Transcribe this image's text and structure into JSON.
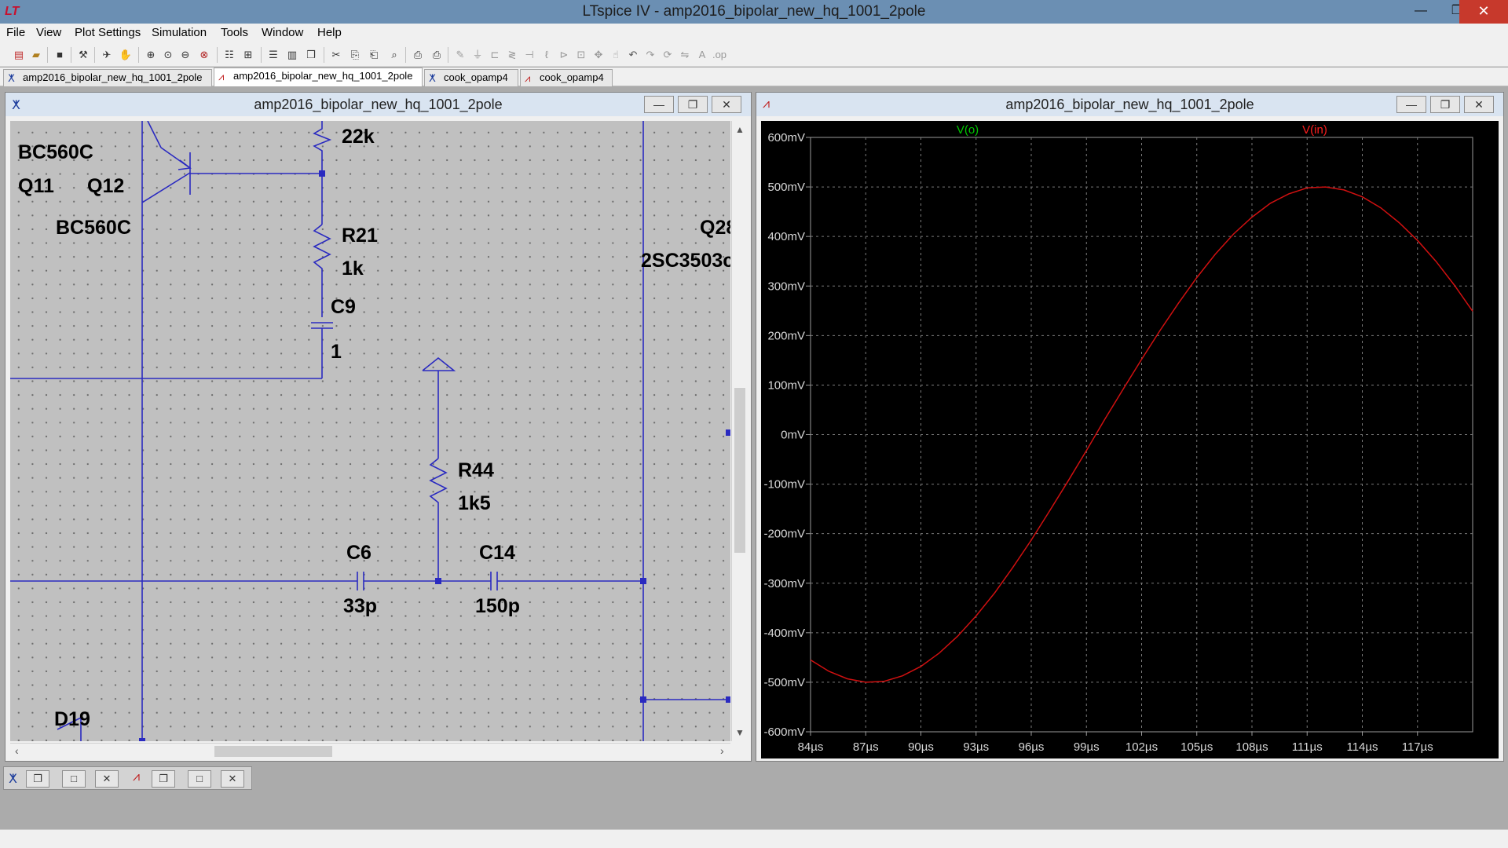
{
  "window": {
    "title": "LTspice IV - amp2016_bipolar_new_hq_1001_2pole",
    "app_icon": "ltspice-logo-icon",
    "min_glyph": "—",
    "max_glyph": "❐",
    "close_glyph": "✕"
  },
  "menu": [
    "File",
    "View",
    "Plot Settings",
    "Simulation",
    "Tools",
    "Window",
    "Help"
  ],
  "tabs": [
    {
      "label": "amp2016_bipolar_new_hq_1001_2pole",
      "icon": "schematic-icon",
      "active": false
    },
    {
      "label": "amp2016_bipolar_new_hq_1001_2pole",
      "icon": "waveform-icon",
      "active": true
    },
    {
      "label": "cook_opamp4",
      "icon": "schematic-icon",
      "active": false
    },
    {
      "label": "cook_opamp4",
      "icon": "waveform-icon",
      "active": false
    }
  ],
  "schematic_window": {
    "title": "amp2016_bipolar_new_hq_1001_2pole",
    "labels": {
      "bc560c_top": "BC560C",
      "q11": "Q11",
      "q12": "Q12",
      "bc560c_bottom": "BC560C",
      "r_top_value": "22k",
      "r21_name": "R21",
      "r21_value": "1k",
      "c9_name": "C9",
      "c9_value": "1",
      "r44_name": "R44",
      "r44_value": "1k5",
      "c6_name": "C6",
      "c6_value": "33p",
      "c14_name": "C14",
      "c14_value": "150p",
      "q28_name": "Q28",
      "q28_model": "2SC3503c",
      "d19_name": "D19"
    },
    "wire_color": "#2a2ac0",
    "background_color": "#c0c0c0"
  },
  "waveform_window": {
    "title": "amp2016_bipolar_new_hq_1001_2pole",
    "trace_labels": [
      {
        "name": "V(o)",
        "color": "#00c800"
      },
      {
        "name": "V(in)",
        "color": "#ff1e1e"
      }
    ]
  },
  "chart_data": {
    "type": "line",
    "title": "",
    "xlabel": "",
    "ylabel": "",
    "xlim": [
      84,
      120
    ],
    "ylim": [
      -600,
      600
    ],
    "x_unit": "µs",
    "y_unit": "mV",
    "x_ticks": [
      "84µs",
      "87µs",
      "90µs",
      "93µs",
      "96µs",
      "99µs",
      "102µs",
      "105µs",
      "108µs",
      "111µs",
      "114µs",
      "117µs"
    ],
    "y_ticks": [
      "600mV",
      "500mV",
      "400mV",
      "300mV",
      "200mV",
      "100mV",
      "0mV",
      "-100mV",
      "-200mV",
      "-300mV",
      "-400mV",
      "-500mV",
      "-600mV"
    ],
    "grid": true,
    "series": [
      {
        "name": "V(in)",
        "color": "#d01010",
        "x": [
          84,
          85,
          86,
          87,
          88,
          89,
          90,
          91,
          92,
          93,
          94,
          95,
          96,
          97,
          98,
          99,
          100,
          101,
          102,
          103,
          104,
          105,
          106,
          107,
          108,
          109,
          110,
          111,
          112,
          113,
          114,
          115,
          116,
          117,
          118,
          119,
          120
        ],
        "values": [
          -455,
          -478,
          -493,
          -500,
          -498,
          -487,
          -468,
          -441,
          -407,
          -366,
          -320,
          -268,
          -213,
          -154,
          -94,
          -32,
          31,
          92,
          152,
          210,
          265,
          317,
          364,
          405,
          439,
          467,
          486,
          498,
          500,
          494,
          480,
          458,
          428,
          392,
          350,
          302,
          249
        ]
      }
    ]
  }
}
